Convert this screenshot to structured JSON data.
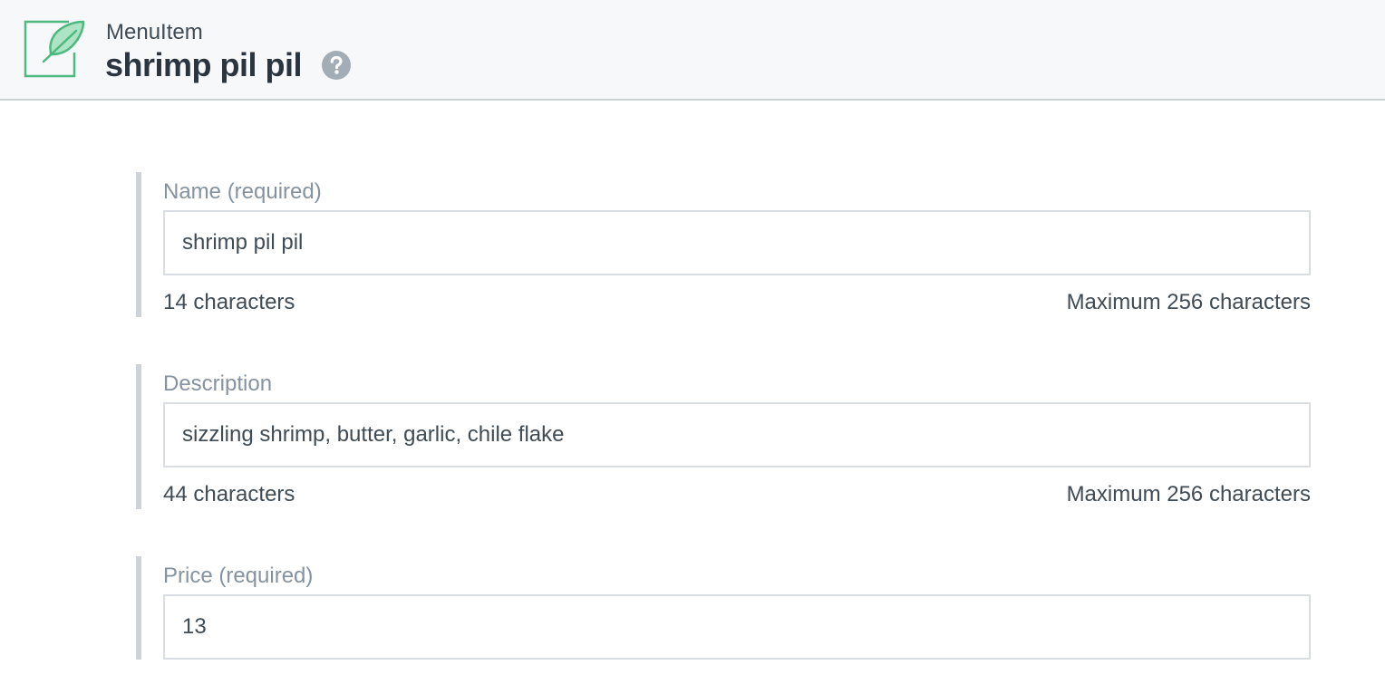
{
  "header": {
    "icon": "feather-icon",
    "type_label": "MenuItem",
    "title": "shrimp pil pil",
    "help_icon": "question-circle-icon",
    "accent_color": "#4cba7f"
  },
  "fields": {
    "name": {
      "label": "Name (required)",
      "value": "shrimp pil pil",
      "count": "14 characters",
      "max": "Maximum 256 characters"
    },
    "description": {
      "label": "Description",
      "value": "sizzling shrimp, butter, garlic, chile flake",
      "count": "44 characters",
      "max": "Maximum 256 characters"
    },
    "price": {
      "label": "Price (required)",
      "value": "13"
    }
  }
}
